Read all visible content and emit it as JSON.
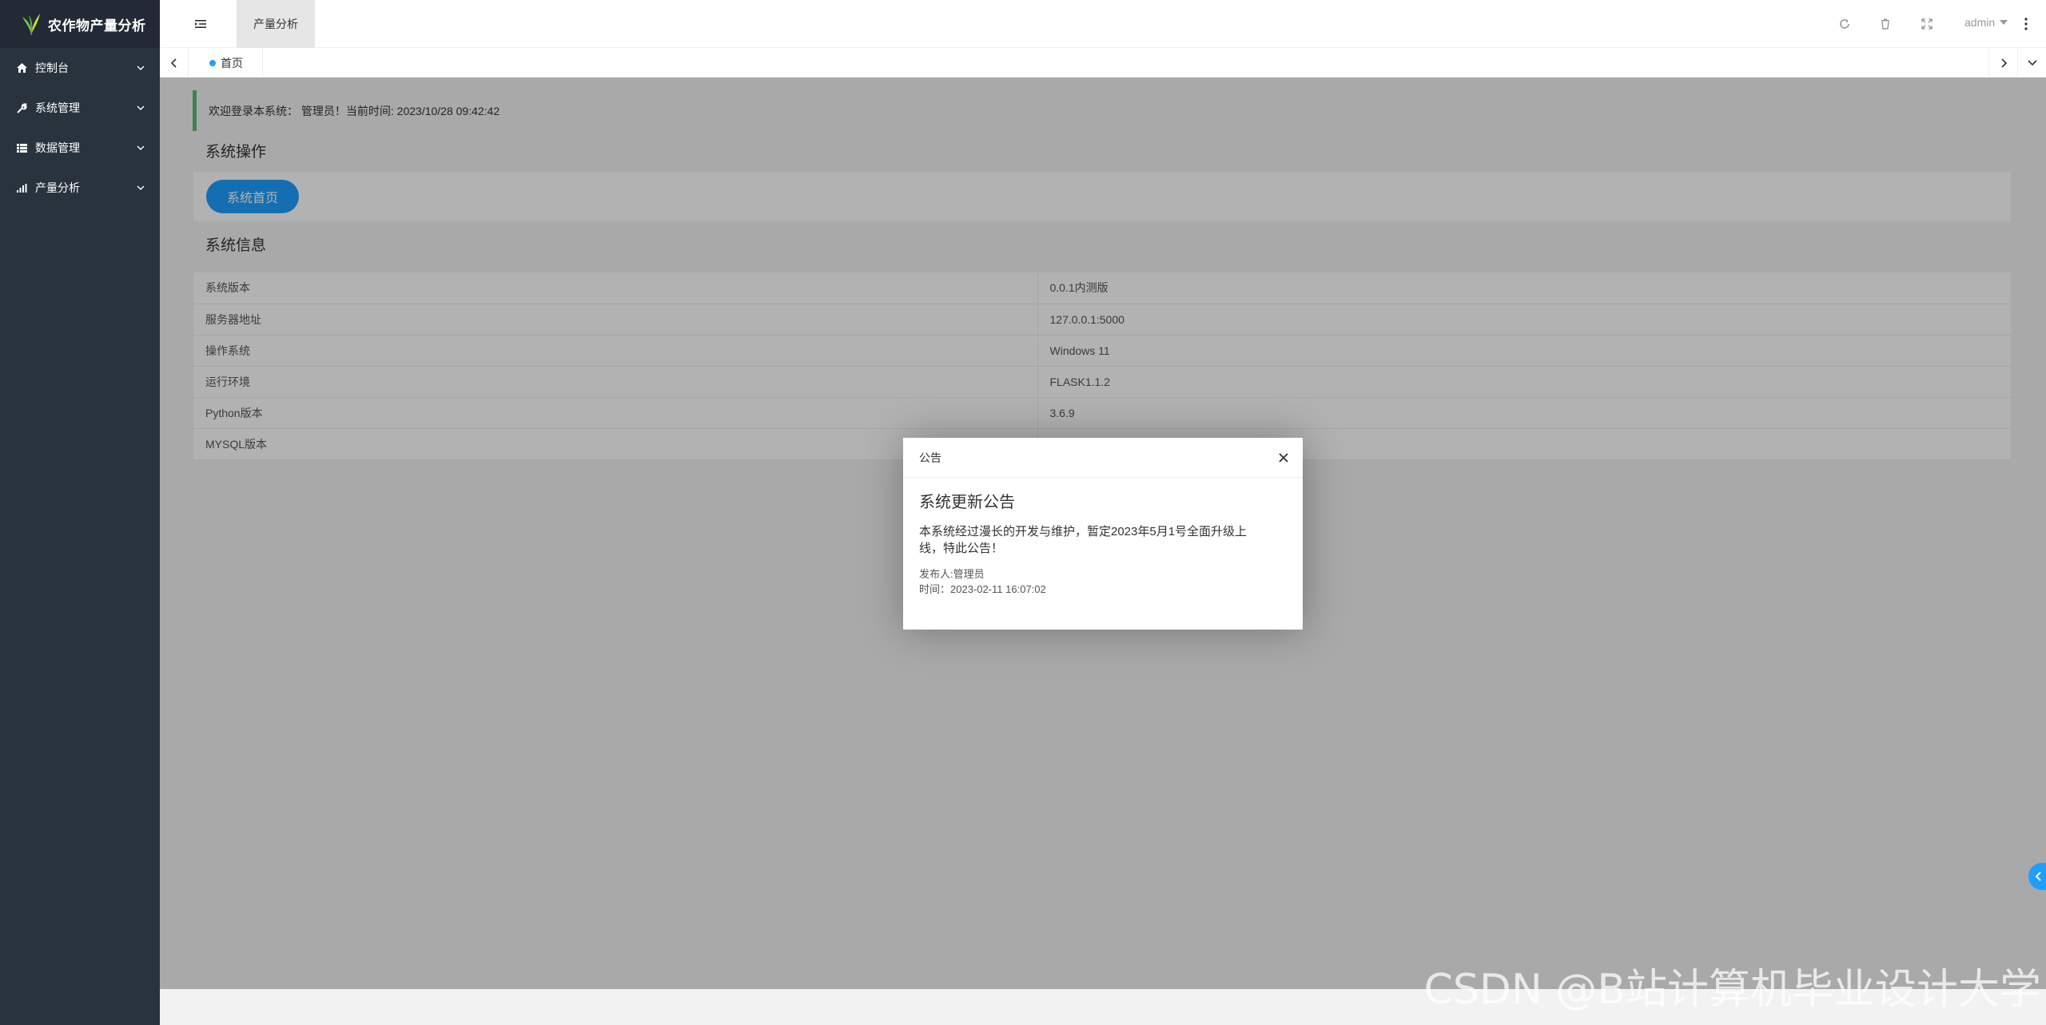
{
  "app": {
    "title": "农作物产量分析"
  },
  "sidebar": {
    "items": [
      {
        "label": "控制台",
        "icon": "home-icon"
      },
      {
        "label": "系统管理",
        "icon": "wrench-icon"
      },
      {
        "label": "数据管理",
        "icon": "list-icon"
      },
      {
        "label": "产量分析",
        "icon": "bar-chart-icon"
      }
    ]
  },
  "header": {
    "active_tab": "产量分析",
    "user": "admin"
  },
  "tabs": {
    "home": "首页"
  },
  "welcome": {
    "text": "欢迎登录本系统： 管理员！当前时间: 2023/10/28 09:42:42"
  },
  "ops": {
    "title": "系统操作",
    "home_button": "系统首页"
  },
  "info": {
    "title": "系统信息",
    "rows": [
      {
        "k": "系统版本",
        "v": "0.0.1内测版"
      },
      {
        "k": "服务器地址",
        "v": "127.0.0.1:5000"
      },
      {
        "k": "操作系统",
        "v": "Windows 11"
      },
      {
        "k": "运行环境",
        "v": "FLASK1.1.2"
      },
      {
        "k": "Python版本",
        "v": "3.6.9"
      },
      {
        "k": "MYSQL版本",
        "v": ""
      }
    ]
  },
  "modal": {
    "header": "公告",
    "title": "系统更新公告",
    "text": "本系统经过漫长的开发与维护，暂定2023年5月1号全面升级上线，特此公告！",
    "publisher": "发布人:管理员",
    "time": "时间：2023-02-11 16:07:02"
  },
  "watermark": "CSDN @B站计算机毕业设计大学",
  "colors": {
    "sidebar": "#28333e",
    "accent": "#1e9fff",
    "green": "#5fb878"
  }
}
